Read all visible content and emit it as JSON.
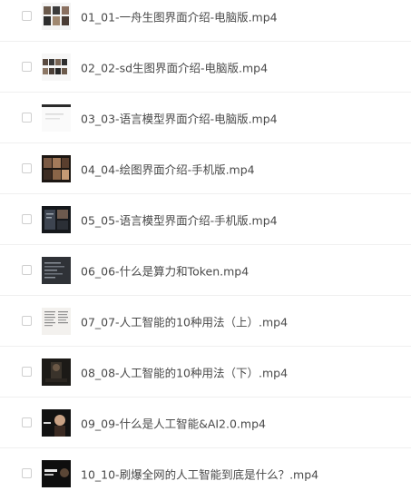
{
  "files": [
    {
      "name": "01_01-一舟生图界面介绍-电脑版.mp4",
      "thumbnail": "gallery-desktop-thumbnail"
    },
    {
      "name": "02_02-sd生图界面介绍-电脑版.mp4",
      "thumbnail": "sd-desktop-thumbnail"
    },
    {
      "name": "03_03-语言模型界面介绍-电脑版.mp4",
      "thumbnail": "chat-desktop-thumbnail"
    },
    {
      "name": "04_04-绘图界面介绍-手机版.mp4",
      "thumbnail": "drawing-mobile-thumbnail"
    },
    {
      "name": "05_05-语言模型界面介绍-手机版.mp4",
      "thumbnail": "chat-mobile-thumbnail"
    },
    {
      "name": "06_06-什么是算力和Token.mp4",
      "thumbnail": "token-thumbnail"
    },
    {
      "name": "07_07-人工智能的10种用法（上）.mp4",
      "thumbnail": "document-thumbnail"
    },
    {
      "name": "08_08-人工智能的10种用法（下）.mp4",
      "thumbnail": "dark-scene-thumbnail"
    },
    {
      "name": "09_09-什么是人工智能&AI2.0.mp4",
      "thumbnail": "portrait-thumbnail"
    },
    {
      "name": "10_10-刷爆全网的人工智能到底是什么？.mp4",
      "thumbnail": "title-card-thumbnail"
    }
  ]
}
